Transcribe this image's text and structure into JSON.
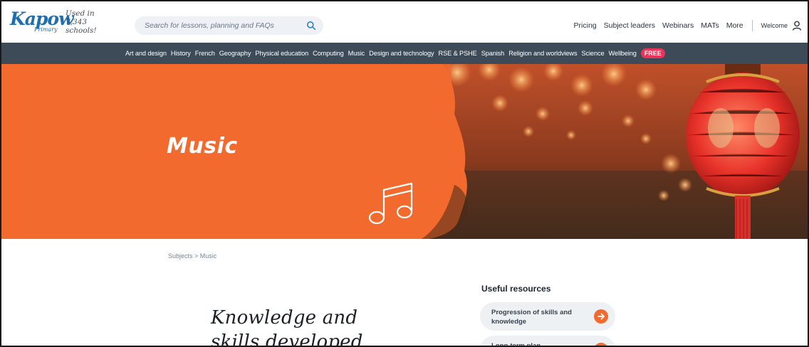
{
  "header": {
    "logo_text": "Kapow",
    "logo_sub": "Primary",
    "used_in": "Used in 7,343 schools!",
    "search_placeholder": "Search for lessons, planning and FAQs",
    "nav": [
      "Pricing",
      "Subject leaders",
      "Webinars",
      "MATs",
      "More"
    ],
    "welcome": "Welcome"
  },
  "subjects": {
    "items": [
      "Art and design",
      "History",
      "French",
      "Geography",
      "Physical education",
      "Computing",
      "Music",
      "Design and technology",
      "RSE & PSHE",
      "Spanish",
      "Religion and worldviews",
      "Science",
      "Wellbeing"
    ],
    "free_badge": "FREE"
  },
  "hero": {
    "title": "Music",
    "icon": "music-note-icon"
  },
  "breadcrumb": "Subjects > Music",
  "main": {
    "heading_line1": "Knowledge and",
    "heading_line2": "skills developed"
  },
  "resources": {
    "title": "Useful resources",
    "cards": [
      {
        "label": "Progression of skills and knowledge"
      },
      {
        "label": "Long-term plan"
      }
    ]
  },
  "colors": {
    "brand_blue": "#1f6fb0",
    "nav_bar": "#3d4a58",
    "hero_orange": "#f26a2e",
    "free_pink": "#e8335a",
    "arrow_orange": "#f26a2e"
  }
}
